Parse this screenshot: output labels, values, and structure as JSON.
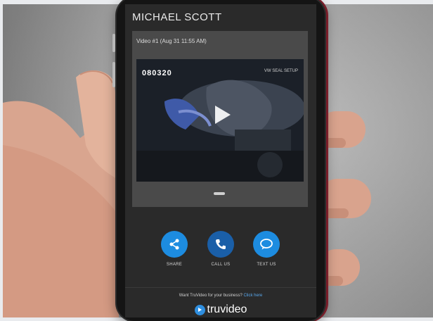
{
  "header": {
    "name": "MICHAEL SCOTT"
  },
  "video_card": {
    "meta": "Video #1 (Aug 31 11:55 AM)",
    "code": "080320",
    "tag": "VW SEAL SETUP"
  },
  "actions": [
    {
      "label": "SHARE",
      "icon": "share-icon"
    },
    {
      "label": "CALL US",
      "icon": "phone-icon"
    },
    {
      "label": "TEXT US",
      "icon": "chat-icon"
    }
  ],
  "footer": {
    "promo_text": "Want TruVideo for your business?",
    "promo_link": "Click here",
    "brand": "truvideo"
  },
  "colors": {
    "accent": "#1d8ce0",
    "screen_bg": "#2a2a2a",
    "card_bg": "#4a4a4a"
  }
}
